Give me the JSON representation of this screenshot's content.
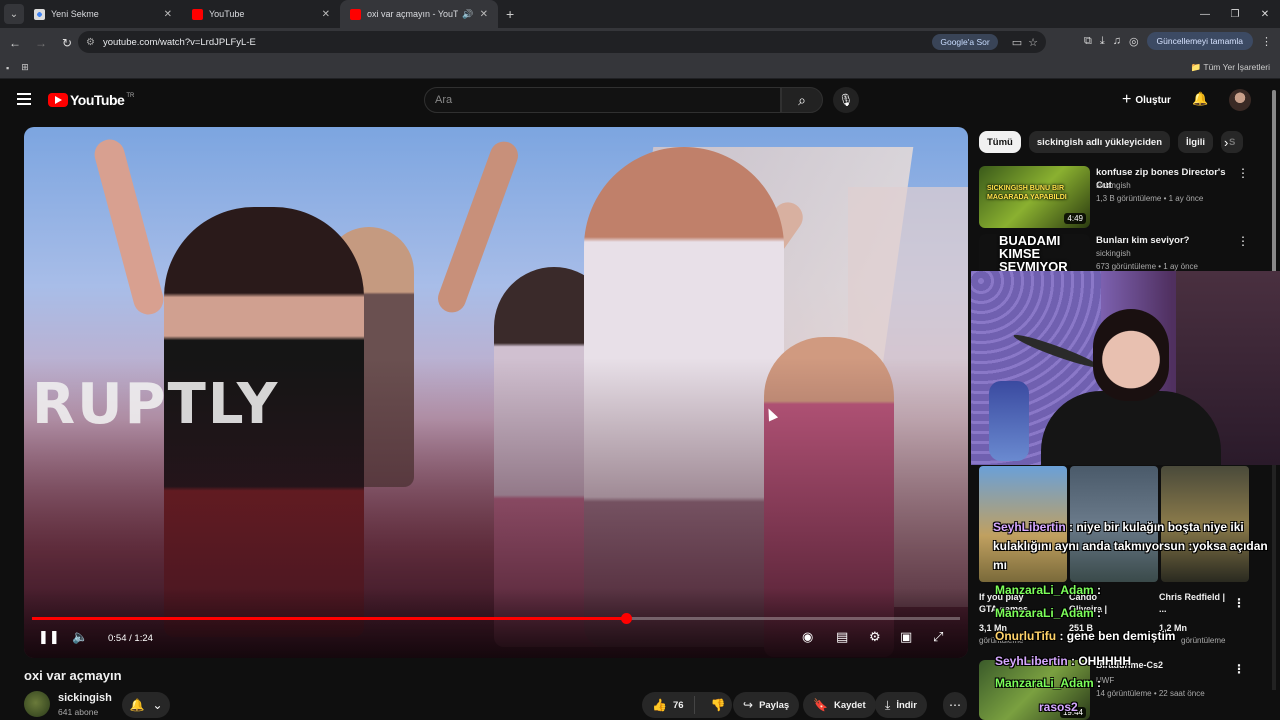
{
  "browser": {
    "tabs": [
      {
        "title": "Yeni Sekme",
        "active": false
      },
      {
        "title": "YouTube",
        "active": false
      },
      {
        "title": "oxi var açmayın - YouTube",
        "active": true
      }
    ],
    "url": "youtube.com/watch?v=LrdJPLFyL-E",
    "google_ask": "Google'a Sor",
    "update_label": "Güncellemeyi tamamla",
    "bookmarks_all": "Tüm Yer İşaretleri"
  },
  "header": {
    "logo": "YouTube",
    "country": "TR",
    "search_placeholder": "Ara",
    "create_label": "Oluştur"
  },
  "player": {
    "watermark": "RUPTLY",
    "time": "0:54 / 1:24",
    "progress": 0.64
  },
  "video": {
    "title": "oxi var açmayın",
    "channel": "sickingish",
    "subscribers": "641 abone",
    "likes": "76",
    "share": "Paylaş",
    "save": "Kaydet",
    "download": "İndir"
  },
  "chips": [
    "Tümü",
    "sickingish adlı yükleyiciden",
    "İlgili",
    "S"
  ],
  "recommendations": [
    {
      "title": "konfuse zip bones Director's Cut",
      "channel": "sickingish",
      "meta": "1,3 B görüntüleme • 1 ay önce",
      "duration": "4:49",
      "thumb_text": "SICKINGISH BUNU BIR MAGARADA YAPABILDI"
    },
    {
      "title": "Bunları kim seviyor?",
      "channel": "sickingish",
      "meta": "673 görüntüleme • 1 ay önce",
      "duration": "",
      "thumb_text": "BUADAMI KIMSE SEVMIYOR"
    }
  ],
  "under_overlay": {
    "col1_title": "If you play GTA games",
    "col1_views": "3,1 Mn",
    "col1_meta": "görüntüleme",
    "col2_title": "Cando Oliveira |",
    "col2_views": "251 B",
    "col3_title": "Chris Redfield | ...",
    "col3_views": "1,2 Mn",
    "col3_meta": "görüntüleme",
    "rec4_title": "Biradurime-Cs2",
    "rec4_channel": "UWF",
    "rec4_meta": "14 görüntüleme • 22 saat önce",
    "rec4_duration": "19:44"
  },
  "chat": [
    {
      "user": "SeyhLibertin",
      "text": " : niye bir kulağın boşta niye iki kulaklığını aynı anda takmıyorsun :yoksa açıdan mı"
    },
    {
      "user": "ManzaraLi_Adam",
      "text": " :"
    },
    {
      "user": "ManzaraLi_Adam",
      "text": " :"
    },
    {
      "user": "OnurluTifu",
      "text": " : gene ben demiştim"
    },
    {
      "user": "SeyhLibertin",
      "text": " : OHHHHH"
    },
    {
      "user": "ManzaraLi_Adam",
      "text": " :"
    },
    {
      "user": "rasos2",
      "text": ""
    }
  ],
  "colors": {
    "accent": "#ff0000",
    "bg": "#0f0f0f",
    "chat_purple": "#d6a8ff",
    "chat_green": "#7cff5a"
  }
}
